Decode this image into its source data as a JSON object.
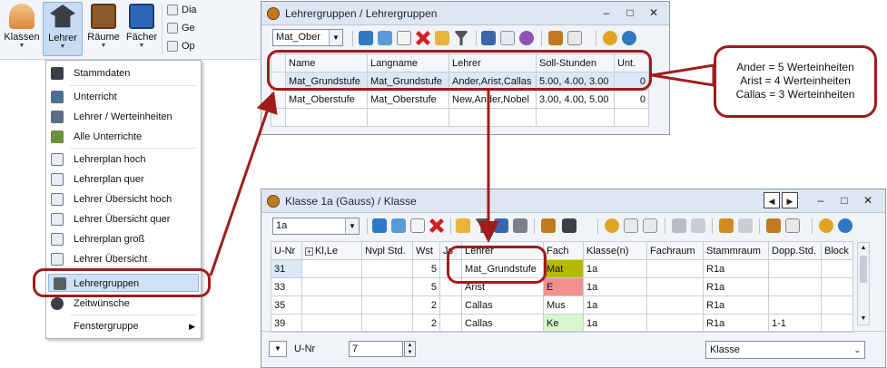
{
  "ribbon": {
    "buttons": [
      {
        "label": "Klassen",
        "icon": "people-icon"
      },
      {
        "label": "Lehrer",
        "icon": "graduation-cap-icon"
      },
      {
        "label": "Räume",
        "icon": "door-icon"
      },
      {
        "label": "Fächer",
        "icon": "book-icon"
      }
    ],
    "small_items": [
      "Dia",
      "Ge",
      "Op"
    ]
  },
  "menu": {
    "items": [
      {
        "label": "Stammdaten"
      },
      {
        "label": "Unterricht"
      },
      {
        "label": "Lehrer / Werteinheiten"
      },
      {
        "label": "Alle Unterrichte"
      },
      {
        "label": "Lehrerplan hoch"
      },
      {
        "label": "Lehrerplan quer"
      },
      {
        "label": "Lehrer Übersicht hoch"
      },
      {
        "label": "Lehrer Übersicht quer"
      },
      {
        "label": "Lehrerplan groß"
      },
      {
        "label": "Lehrer Übersicht"
      },
      {
        "label": "Lehrergruppen"
      },
      {
        "label": "Zeitwünsche"
      },
      {
        "label": "Fenstergruppe"
      }
    ]
  },
  "groups_window": {
    "title": "Lehrergruppen / Lehrergruppen",
    "combo_value": "Mat_Ober",
    "columns": [
      "Name",
      "Langname",
      "Lehrer",
      "Soll-Stunden",
      "Unt."
    ],
    "rows": [
      [
        "Mat_Grundstufe",
        "Mat_Grundstufe",
        "Ander,Arist,Callas",
        "5.00, 4.00, 3.00",
        "0"
      ],
      [
        "Mat_Oberstufe",
        "Mat_Oberstufe",
        "New,Ander,Nobel",
        "3.00, 4.00, 5.00",
        "0"
      ]
    ]
  },
  "callout": {
    "lines": [
      "Ander = 5 Werteinheiten",
      "Arist = 4 Werteinheiten",
      "Callas = 3 Werteinheiten"
    ]
  },
  "class_window": {
    "title": "Klasse 1a (Gauss) / Klasse",
    "combo_value": "1a",
    "columns": [
      "U-Nr",
      "Kl,Le",
      "Nvpl Std.",
      "Wst",
      "Js",
      "Lehrer",
      "Fach",
      "Klasse(n)",
      "Fachraum",
      "Stammraum",
      "Dopp.Std.",
      "Block"
    ],
    "rows": [
      [
        "31",
        "",
        "",
        "5",
        "",
        "Mat_Grundstufe",
        "Mat",
        "1a",
        "",
        "R1a",
        "",
        ""
      ],
      [
        "33",
        "",
        "",
        "5",
        "",
        "Arist",
        "E",
        "1a",
        "",
        "R1a",
        "",
        ""
      ],
      [
        "35",
        "",
        "",
        "2",
        "",
        "Callas",
        "Mus",
        "1a",
        "",
        "R1a",
        "",
        ""
      ],
      [
        "39",
        "",
        "",
        "2",
        "",
        "Callas",
        "Ke",
        "1a",
        "",
        "R1a",
        "1-1",
        ""
      ]
    ],
    "fach_colors": [
      "#b5b800",
      "#f29090",
      "#ffffff",
      "#d9f5d0"
    ],
    "footer": {
      "field_label": "U-Nr",
      "field_value": "7",
      "view_select": "Klasse"
    }
  },
  "colors": {
    "accent_red": "#a01c1c",
    "selection": "#cfe1f4"
  }
}
